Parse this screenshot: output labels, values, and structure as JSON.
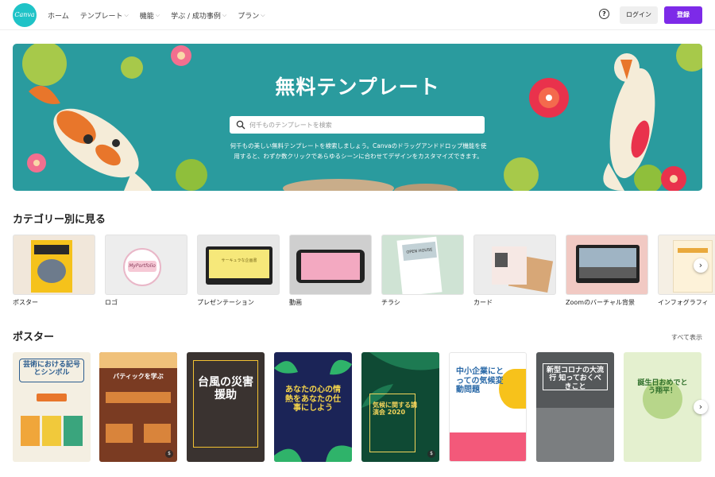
{
  "header": {
    "logo_text": "Canva",
    "nav": [
      {
        "label": "ホーム",
        "chevron": false
      },
      {
        "label": "テンプレート",
        "chevron": true
      },
      {
        "label": "機能",
        "chevron": true
      },
      {
        "label": "学ぶ / 成功事例",
        "chevron": true
      },
      {
        "label": "プラン",
        "chevron": true
      }
    ],
    "help_icon": "question-circle-icon",
    "login_label": "ログイン",
    "signup_label": "登録",
    "accent_color": "#7d2ae8"
  },
  "hero": {
    "title": "無料テンプレート",
    "search_placeholder": "何千ものテンプレートを検索",
    "description": "何千もの美しい無料テンプレートを検索しましょう。Canvaのドラッグアンドドロップ機能を使用すると、わずか数クリックであらゆるシーンに合わせてデザインをカスタマイズできます。",
    "bg_color": "#2a9b9e"
  },
  "categories": {
    "title": "カテゴリー別に見る",
    "items": [
      {
        "label": "ポスター",
        "icon": "poster-thumbnail"
      },
      {
        "label": "ロゴ",
        "thumb_text": "MyPortfolio",
        "icon": "logo-thumbnail"
      },
      {
        "label": "プレゼンテーション",
        "thumb_text": "サーキュラな企画書",
        "icon": "presentation-thumbnail"
      },
      {
        "label": "動画",
        "icon": "video-thumbnail"
      },
      {
        "label": "チラシ",
        "thumb_text": "OPEN HOUSE",
        "icon": "flyer-thumbnail"
      },
      {
        "label": "カード",
        "icon": "card-thumbnail"
      },
      {
        "label": "Zoomのバーチャル背景",
        "icon": "zoom-background-thumbnail"
      },
      {
        "label": "インフォグラフィ",
        "icon": "infographic-thumbnail"
      }
    ]
  },
  "posters": {
    "title": "ポスター",
    "see_all": "すべて表示",
    "items": [
      {
        "text": "芸術における記号とシンボル",
        "bg": "#f4efe2",
        "fg": "#2c5d8f",
        "badge": false
      },
      {
        "text": "バティックを学ぶ",
        "bg": "#7a3b22",
        "fg": "#ffffff",
        "badge": true
      },
      {
        "text": "台風の災害援助",
        "bg": "#3a3330",
        "fg": "#ffffff",
        "badge": false
      },
      {
        "text": "あなたの心の情熱をあなたの仕事にしよう",
        "bg": "#1b2457",
        "fg": "#f6d54a",
        "badge": false
      },
      {
        "text": "気候に関する講演会 2020",
        "bg": "#0f4a34",
        "fg": "#f2d35b",
        "badge": true
      },
      {
        "text": "中小企業にとっての気候変動問題",
        "bg": "#ffffff",
        "fg": "#2b6aa8",
        "badge": false
      },
      {
        "text": "新型コロナの大流行 知っておくべきこと",
        "bg": "#55585a",
        "fg": "#ffffff",
        "badge": false
      },
      {
        "text": "誕生日おめでとう翔平！",
        "bg": "#e4f0cf",
        "fg": "#2f6f2a",
        "badge": false
      }
    ]
  }
}
